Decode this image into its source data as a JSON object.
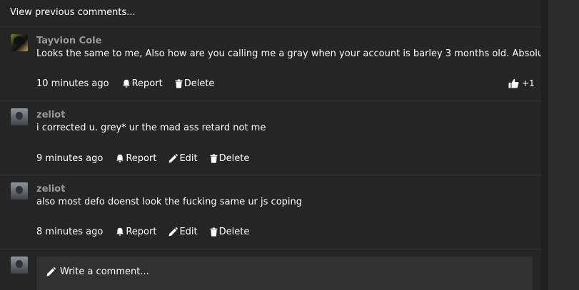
{
  "thread": {
    "view_previous_label": "View previous comments..."
  },
  "comments": [
    {
      "author": "Tayvion Cole",
      "text": "Looks the same to me, Also how are you calling me a gray when your account is barley 3 months old. Absolute retard",
      "time": "10 minutes ago",
      "report_label": "Report",
      "delete_label": "Delete",
      "likes": "+1"
    },
    {
      "author": "zeliot",
      "text": "i corrected u. grey* ur the mad ass retard not me",
      "time": "9 minutes ago",
      "report_label": "Report",
      "edit_label": "Edit",
      "delete_label": "Delete"
    },
    {
      "author": "zeliot",
      "text": "also most defo doenst look the fucking same ur js coping",
      "time": "8 minutes ago",
      "report_label": "Report",
      "edit_label": "Edit",
      "delete_label": "Delete"
    }
  ],
  "composer": {
    "placeholder": "Write a comment..."
  },
  "icons": {
    "report": "bell-icon",
    "edit": "pencil-icon",
    "delete": "trash-icon",
    "like": "thumbs-up-icon",
    "composer": "pencil-icon"
  }
}
